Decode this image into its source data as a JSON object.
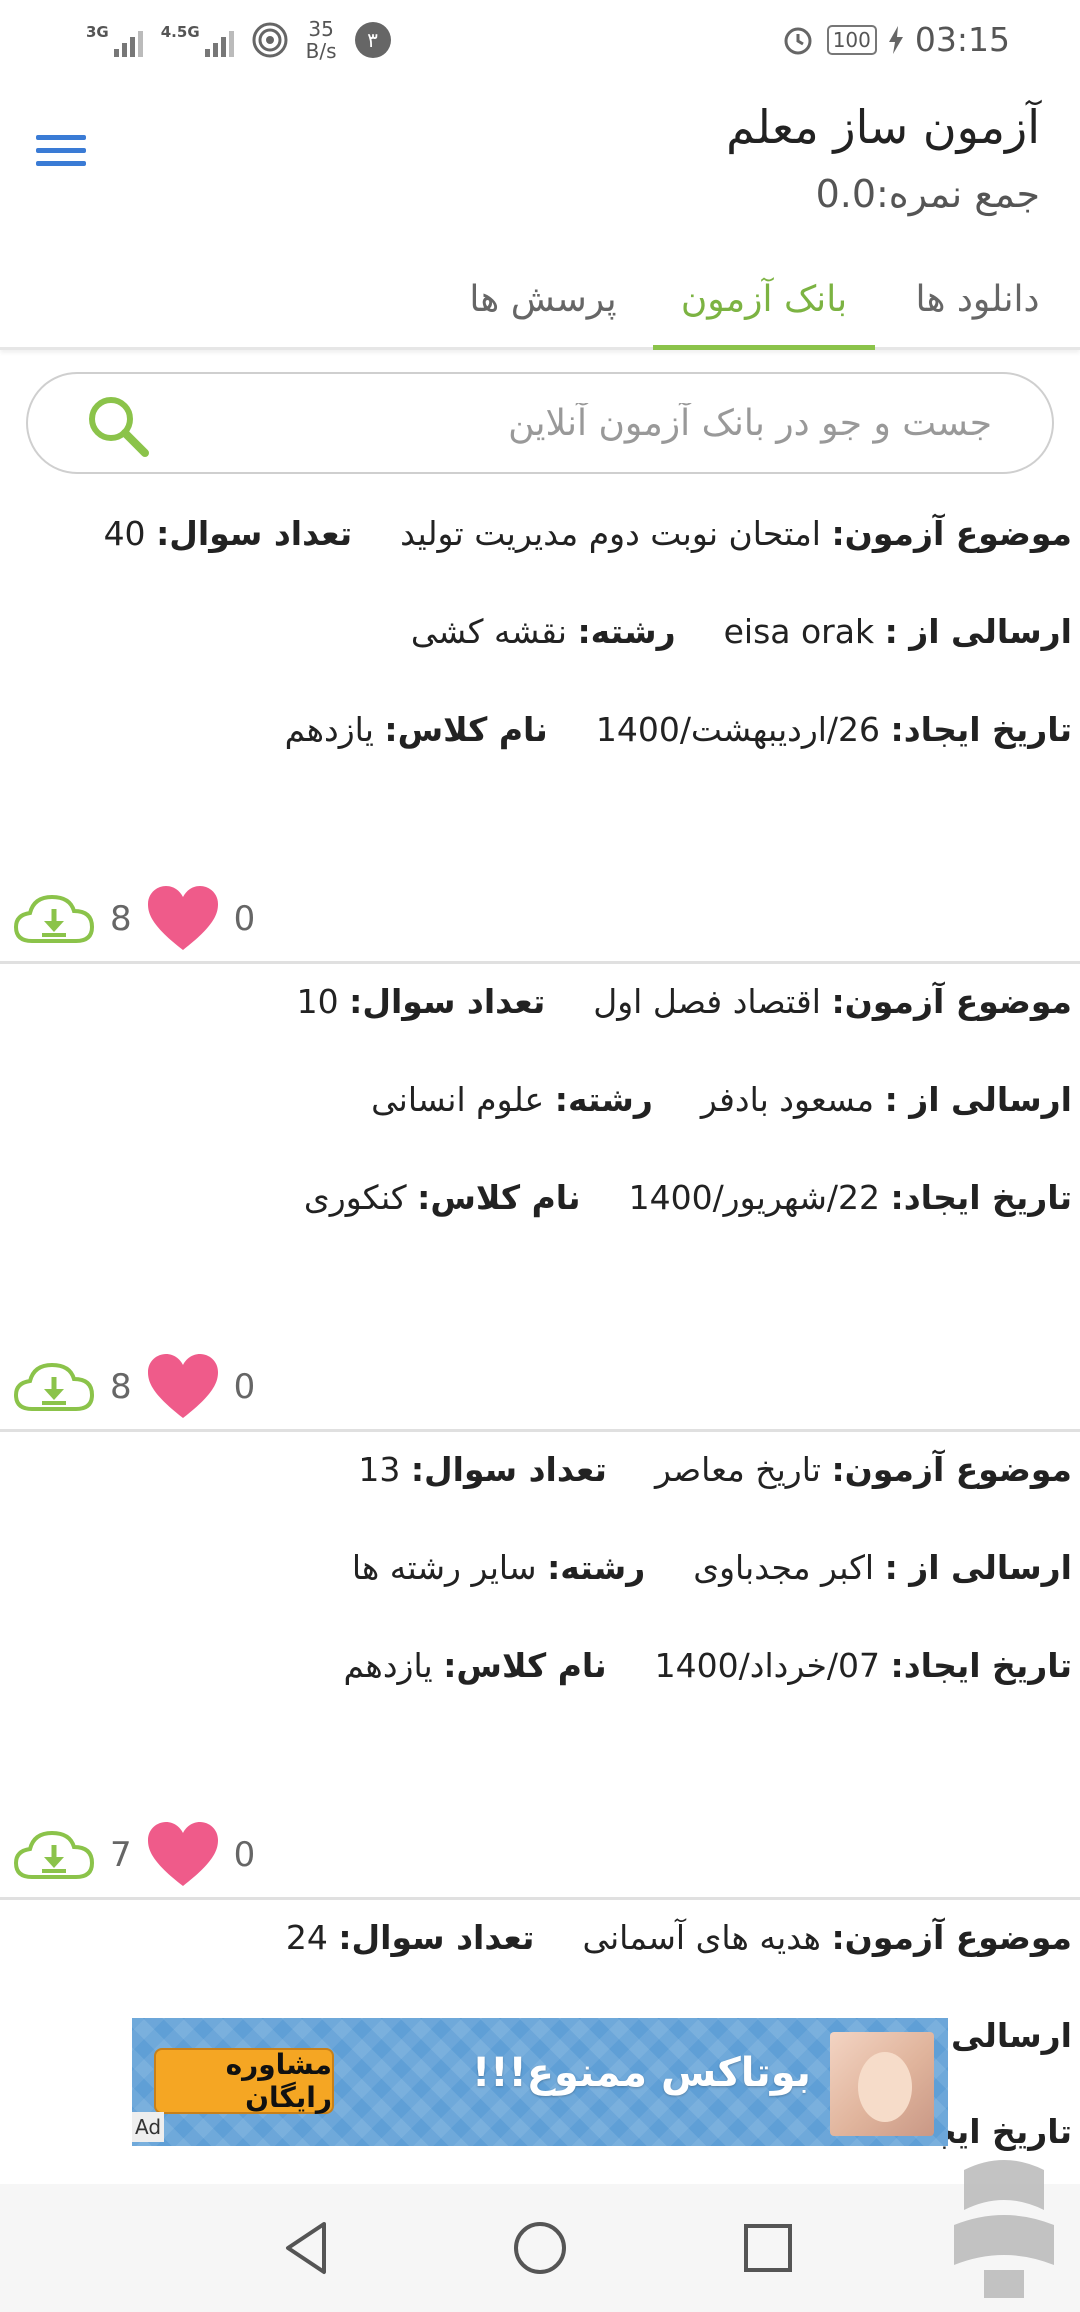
{
  "status_bar": {
    "network1": "3G",
    "network2": "4.5G",
    "speed_value": "35",
    "speed_unit": "B/s",
    "notification_count": "۳",
    "battery": "100",
    "time": "03:15"
  },
  "header": {
    "title": "آزمون ساز معلم",
    "score": "جمع نمره:0.0",
    "tabs": [
      {
        "label": "پرسش ها",
        "active": false
      },
      {
        "label": "بانک آزمون",
        "active": true
      },
      {
        "label": "دانلود ها",
        "active": false
      }
    ],
    "accent_color": "#8bc34a",
    "menu_color": "#3a7bd5"
  },
  "search": {
    "placeholder": "جست و جو در بانک آزمون آنلاین"
  },
  "labels": {
    "subject": "موضوع آزمون:",
    "question_count": "تعداد سوال:",
    "sender": "ارسالی از :",
    "field": "رشته:",
    "created": "تاریخ ایجاد:",
    "class_name": "نام کلاس:"
  },
  "exams": [
    {
      "subject": "امتحان نوبت دوم مدیریت تولید",
      "questions": "40",
      "sender": "eisa orak",
      "field": "نقشه کشی",
      "created": "26/اردیبهشت/1400",
      "class_name": "یازدهم",
      "downloads": "8",
      "likes": "0"
    },
    {
      "subject": "اقتصاد فصل اول",
      "questions": "10",
      "sender": "مسعود بادفر",
      "field": "علوم انسانی",
      "created": "22/شهریور/1400",
      "class_name": "کنکوری",
      "downloads": "8",
      "likes": "0"
    },
    {
      "subject": "تاریخ معاصر",
      "questions": "13",
      "sender": "اکبر مجدباوی",
      "field": "سایر رشته ها",
      "created": "07/خرداد/1400",
      "class_name": "یازدهم",
      "downloads": "7",
      "likes": "0"
    },
    {
      "subject": "هدیه های آسمانی",
      "questions": "24"
    }
  ],
  "ad": {
    "headline": "بوتاکس ممنوع!!!",
    "button": "مشاوره رایگان",
    "tag": "Ad"
  },
  "colors": {
    "heart": "#ef5b8a",
    "download": "#8bc34a"
  }
}
